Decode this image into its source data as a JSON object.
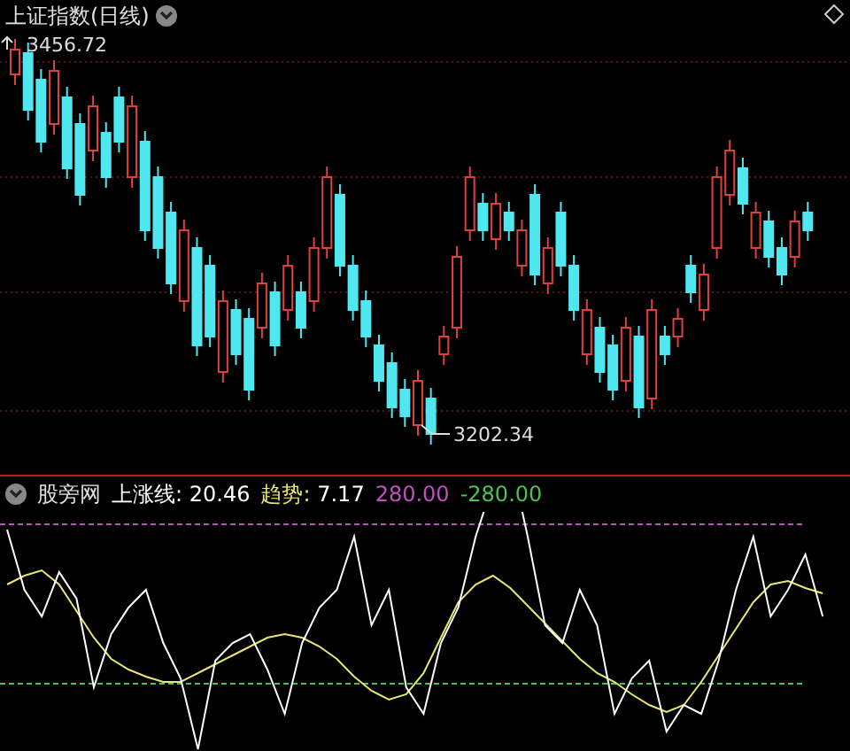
{
  "main_chart": {
    "title": "上证指数(日线)",
    "high_label": "3456.72",
    "low_label": "3202.34"
  },
  "indicator": {
    "name": "股旁网",
    "fields": [
      {
        "label": "上涨线:",
        "value": "20.46",
        "color": "#ffffff"
      },
      {
        "label": "趋势:",
        "value": "7.17",
        "color": "#e8e870"
      },
      {
        "value": "280.00",
        "color": "#c050c0"
      },
      {
        "value": "-280.00",
        "color": "#50c050"
      }
    ]
  }
}
